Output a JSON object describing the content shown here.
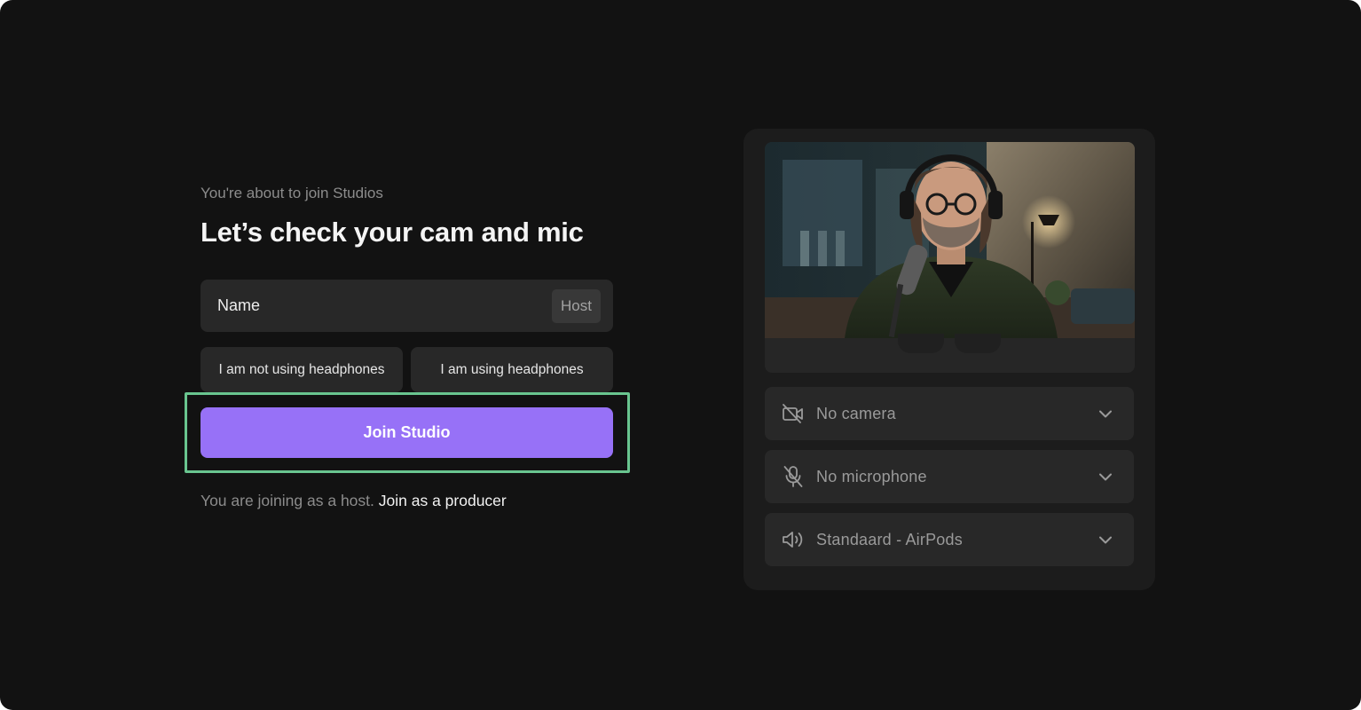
{
  "intro": {
    "subtitle": "You're about to join Studios",
    "title": "Let’s check your cam and mic"
  },
  "name_field": {
    "placeholder": "Name",
    "value": "",
    "role_badge": "Host"
  },
  "headphones": {
    "not_using_label": "I am not using headphones",
    "using_label": "I am using headphones"
  },
  "join": {
    "button_label": "Join Studio",
    "note_text": "You are joining as a host.",
    "producer_link": "Join as a producer"
  },
  "devices": {
    "camera": {
      "label": "No camera",
      "icon": "camera-off-icon"
    },
    "microphone": {
      "label": "No microphone",
      "icon": "mic-off-icon"
    },
    "speaker": {
      "label": "Standaard - AirPods",
      "icon": "speaker-icon"
    }
  },
  "colors": {
    "background": "#121212",
    "panel": "#1c1c1c",
    "field": "#282828",
    "accent": "#9771f7",
    "highlight": "#69c58f"
  }
}
